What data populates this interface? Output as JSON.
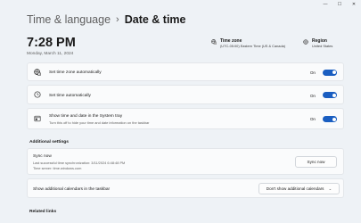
{
  "window": {
    "controls": [
      "—",
      "☐",
      "✕"
    ]
  },
  "breadcrumb": {
    "parent": "Time & language",
    "separator": "›",
    "current": "Date & time"
  },
  "clock": {
    "time": "7:28 PM",
    "date": "Monday, March 11, 2024"
  },
  "timezone_info": {
    "label": "Time zone",
    "value": "(UTC-05:00) Eastern Time (US & Canada)",
    "icon": "globe-clock-icon"
  },
  "region_info": {
    "label": "Region",
    "value": "United States",
    "icon": "globe-icon"
  },
  "settings": [
    {
      "title": "Set time zone automatically",
      "state": "On",
      "on": true,
      "icon": "globe-clock-icon"
    },
    {
      "title": "Set time automatically",
      "state": "On",
      "on": true,
      "icon": "clock-icon"
    },
    {
      "title": "Show time and date in the System tray",
      "subtitle": "Turn this off to hide your time and date information on the taskbar",
      "state": "On",
      "on": true,
      "icon": "taskbar-calendar-icon"
    }
  ],
  "additional": {
    "title": "Additional settings",
    "sync": {
      "title": "Sync now",
      "last_sync": "Last successful time synchronization: 3/11/2024 6:48:48 PM",
      "server": "Time server: time.windows.com",
      "button": "Sync now"
    },
    "calendars": {
      "label": "Show additional calendars in the taskbar",
      "selected": "Don't show additional calendars"
    }
  },
  "related": {
    "title": "Related links"
  },
  "colors": {
    "accent": "#1a5ec1",
    "background": "#eef2f6",
    "card": "#fafbfc"
  }
}
